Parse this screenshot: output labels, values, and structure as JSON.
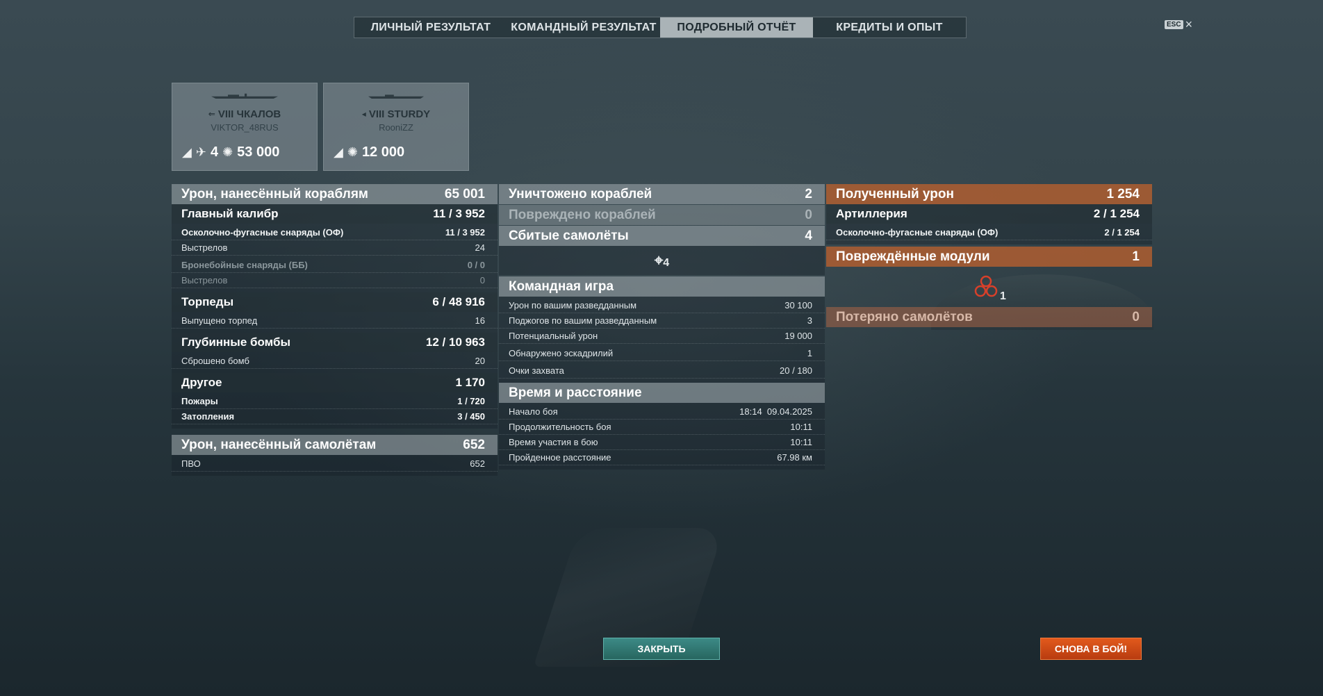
{
  "tabs": [
    "ЛИЧНЫЙ РЕЗУЛЬТАТ",
    "КОМАНДНЫЙ РЕЗУЛЬТАТ",
    "ПОДРОБНЫЙ ОТЧЁТ",
    "КРЕДИТЫ И ОПЫТ"
  ],
  "active_tab": 2,
  "esc": {
    "key": "ESC",
    "close": "×"
  },
  "ships": [
    {
      "name": "VIII ЧКАЛОВ",
      "player": "VIKTOR_48RUS",
      "kills": "4",
      "damage": "53 000"
    },
    {
      "name": "VIII STURDY",
      "player": "RooniZZ",
      "damage": "12 000"
    }
  ],
  "left": {
    "ship_damage": {
      "label": "Урон, нанесённый кораблям",
      "value": "65 001"
    },
    "main_battery": {
      "label": "Главный калибр",
      "hits": "11",
      "value": "3 952"
    },
    "he": {
      "label": "Осколочно-фугасные снаряды (ОФ)",
      "value": "11 / 3 952"
    },
    "he_shots": {
      "label": "Выстрелов",
      "value": "24"
    },
    "ap": {
      "label": "Бронебойные снаряды (ББ)",
      "value": "0 / 0"
    },
    "ap_shots": {
      "label": "Выстрелов",
      "value": "0"
    },
    "torpedoes": {
      "label": "Торпеды",
      "hits": "6",
      "value": "48 916"
    },
    "torp_fired": {
      "label": "Выпущено торпед",
      "value": "16"
    },
    "depth": {
      "label": "Глубинные бомбы",
      "hits": "12",
      "value": "10 963"
    },
    "bombs_dropped": {
      "label": "Сброшено бомб",
      "value": "20"
    },
    "other": {
      "label": "Другое",
      "value": "1 170"
    },
    "fires": {
      "label": "Пожары",
      "hits": "1",
      "value": "720"
    },
    "floods": {
      "label": "Затопления",
      "hits": "3",
      "value": "450"
    },
    "plane_damage": {
      "label": "Урон, нанесённый самолётам",
      "value": "652"
    },
    "aa": {
      "label": "ПВО",
      "value": "652"
    }
  },
  "middle": {
    "destroyed": {
      "label": "Уничтожено кораблей",
      "value": "2"
    },
    "damaged": {
      "label": "Повреждено кораблей",
      "value": "0"
    },
    "planes": {
      "label": "Сбитые самолёты",
      "value": "4"
    },
    "planes_icon_count": "4",
    "team": {
      "label": "Командная игра"
    },
    "spotting_damage": {
      "label": "Урон по вашим разведданным",
      "value": "30 100"
    },
    "spotting_fires": {
      "label": "Поджогов по вашим разведданным",
      "value": "3"
    },
    "potential": {
      "label": "Потенциальный урон",
      "value": "19 000"
    },
    "squadrons": {
      "label": "Обнаружено эскадрилий",
      "value": "1"
    },
    "capture": {
      "label": "Очки захвата",
      "value": "20 / 180"
    },
    "time": {
      "label": "Время и расстояние"
    },
    "start": {
      "label": "Начало боя",
      "value": "18:14  09.04.2025"
    },
    "duration": {
      "label": "Продолжительность боя",
      "value": "10:11"
    },
    "participation": {
      "label": "Время участия в бою",
      "value": "10:11"
    },
    "distance": {
      "label": "Пройденное расстояние",
      "value": "67.98 км"
    }
  },
  "right": {
    "received": {
      "label": "Полученный урон",
      "value": "1 254"
    },
    "artillery": {
      "label": "Артиллерия",
      "hits": "2",
      "value": "1 254"
    },
    "he": {
      "label": "Осколочно-фугасные снаряды (ОФ)",
      "hits": "2",
      "value": "1 254"
    },
    "modules": {
      "label": "Повреждённые модули",
      "value": "1"
    },
    "module_icon_count": "1",
    "planes_lost": {
      "label": "Потеряно самолётов",
      "value": "0"
    }
  },
  "buttons": {
    "close": "ЗАКРЫТЬ",
    "battle": "СНОВА В БОЙ!"
  }
}
